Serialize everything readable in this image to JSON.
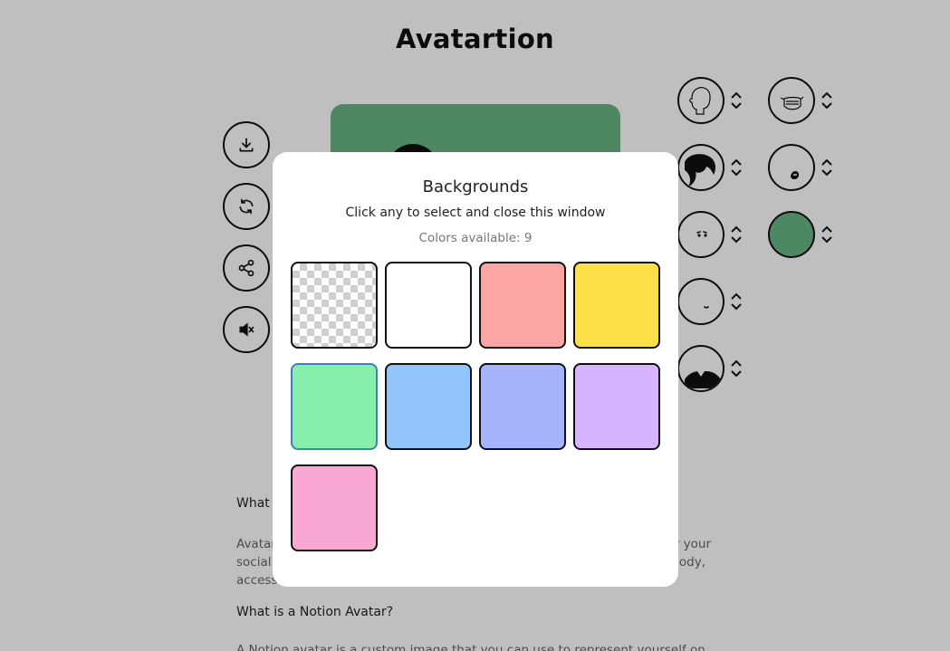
{
  "app": {
    "title": "Avatartion"
  },
  "sidebar": {
    "buttons": [
      {
        "name": "download-button",
        "icon": "download-icon"
      },
      {
        "name": "randomize-button",
        "icon": "refresh-icon"
      },
      {
        "name": "share-button",
        "icon": "share-icon"
      },
      {
        "name": "sound-toggle-button",
        "icon": "mute-icon"
      }
    ]
  },
  "parts": {
    "left_column": [
      "face",
      "hair",
      "eyes",
      "mouth",
      "outfit"
    ],
    "right_column": [
      "accessories",
      "beard",
      "background-color"
    ]
  },
  "faq": {
    "q1_visible": "What i",
    "a1_line1_visible": "Avatar",
    "a1_line1_tail": "r your",
    "a1_line2_visible": "social",
    "a1_line2_tail": "body,",
    "a1_line3_visible": "access",
    "q2": "What is a Notion Avatar?",
    "a2_partial": "A Notion avatar is a custom image that you can use to represent yourself on"
  },
  "modal": {
    "title": "Backgrounds",
    "subtitle": "Click any to select and close this window",
    "count_text": "Colors available: 9",
    "swatches": [
      {
        "name": "swatch-transparent",
        "color": "transparent"
      },
      {
        "name": "swatch-white",
        "color": "#ffffff"
      },
      {
        "name": "swatch-salmon",
        "color": "#fca5a5"
      },
      {
        "name": "swatch-yellow",
        "color": "#fde047"
      },
      {
        "name": "swatch-green",
        "color": "#86efac",
        "selected": true
      },
      {
        "name": "swatch-blue",
        "color": "#93c5fd"
      },
      {
        "name": "swatch-indigo",
        "color": "#a5b4fc"
      },
      {
        "name": "swatch-purple",
        "color": "#d8b4fe"
      },
      {
        "name": "swatch-pink",
        "color": "#f9a8d4"
      }
    ]
  },
  "colors": {
    "avatar_background": "#67b685",
    "overlay": "rgba(0,0,0,0.25)"
  }
}
